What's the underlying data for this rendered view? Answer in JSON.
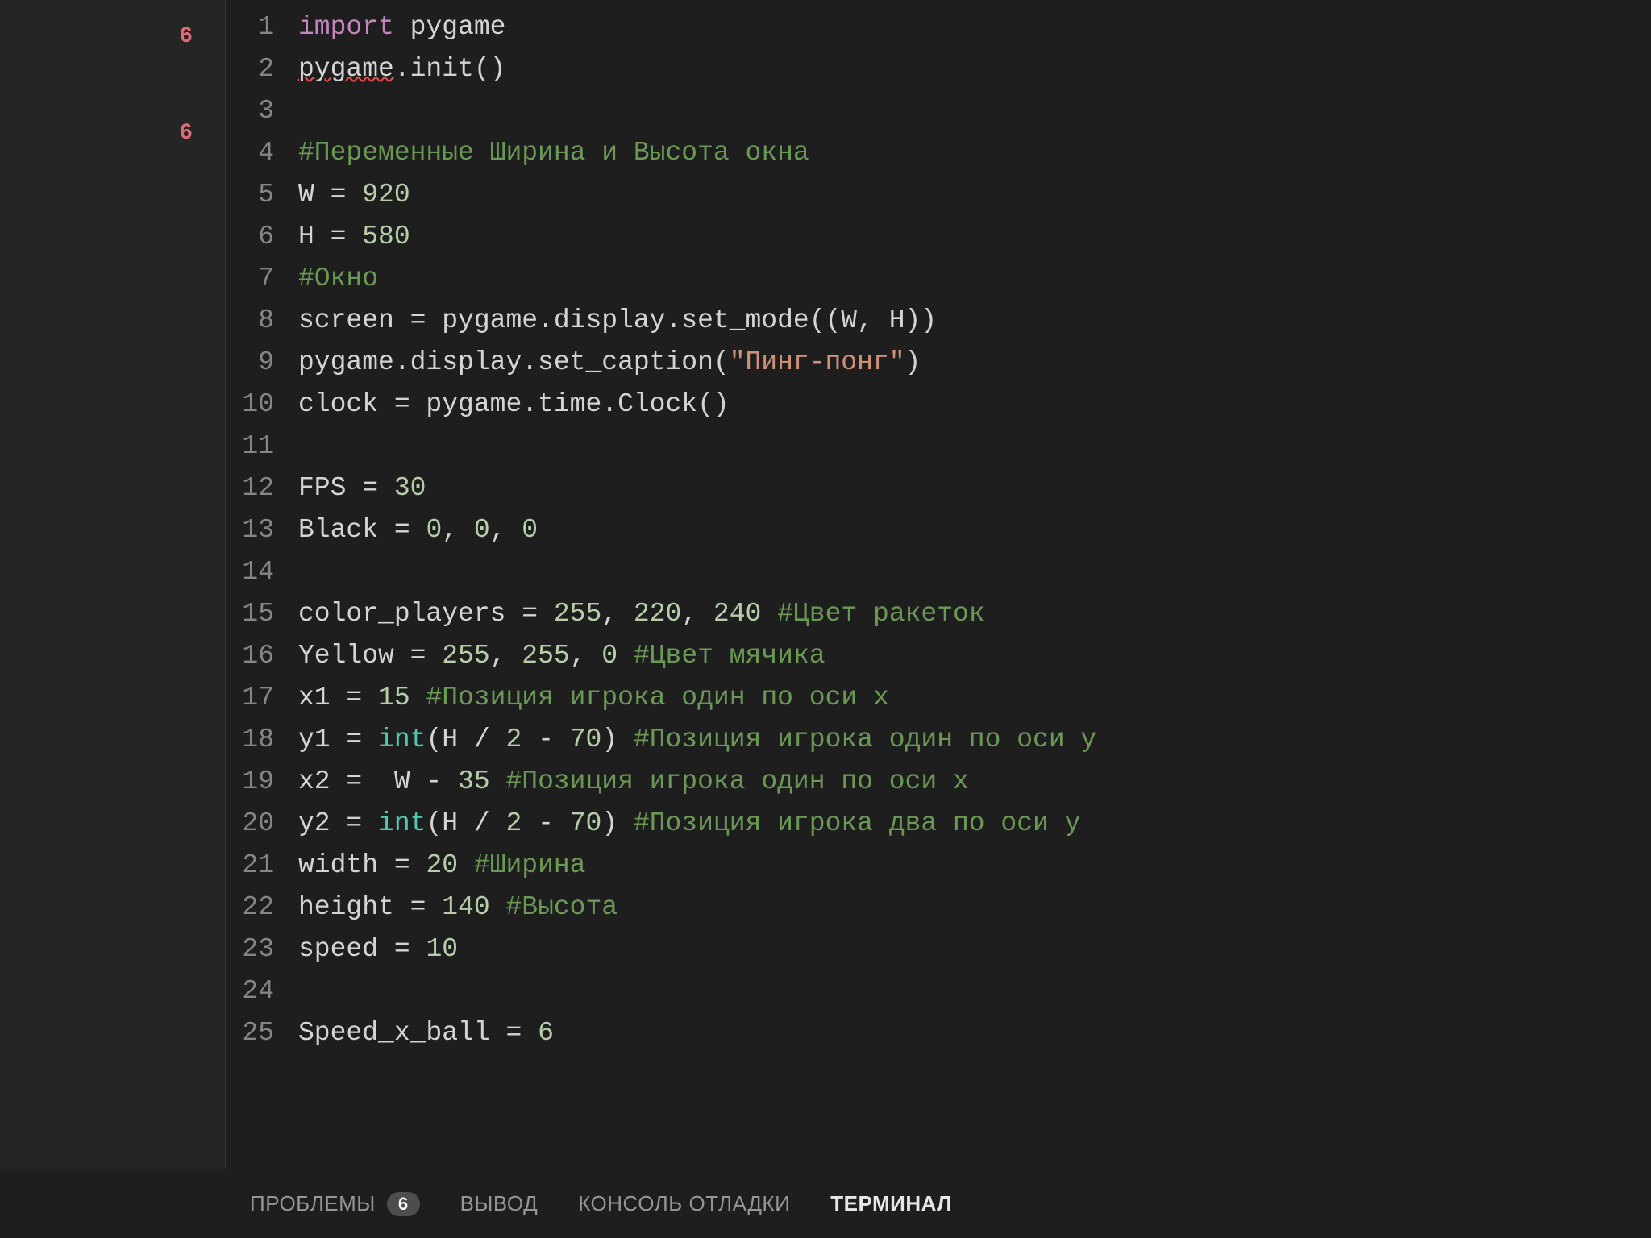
{
  "sidebar": {
    "badge1": "6",
    "badge2": "6"
  },
  "code": {
    "lines": [
      {
        "n": 1,
        "tokens": [
          {
            "c": "kw-import",
            "t": "import"
          },
          {
            "c": "default",
            "t": " "
          },
          {
            "c": "ident",
            "t": "pygame"
          }
        ]
      },
      {
        "n": 2,
        "tokens": [
          {
            "c": "ident squiggle",
            "t": "pygame"
          },
          {
            "c": "default",
            "t": ".init()"
          }
        ]
      },
      {
        "n": 3,
        "tokens": [
          {
            "c": "default",
            "t": ""
          }
        ]
      },
      {
        "n": 4,
        "tokens": [
          {
            "c": "comment",
            "t": "#Переменные Ширина и Высота окна"
          }
        ]
      },
      {
        "n": 5,
        "tokens": [
          {
            "c": "default",
            "t": "W = "
          },
          {
            "c": "number",
            "t": "920"
          }
        ]
      },
      {
        "n": 6,
        "tokens": [
          {
            "c": "default",
            "t": "H = "
          },
          {
            "c": "number",
            "t": "580"
          }
        ]
      },
      {
        "n": 7,
        "tokens": [
          {
            "c": "comment",
            "t": "#Окно"
          }
        ]
      },
      {
        "n": 8,
        "tokens": [
          {
            "c": "default",
            "t": "screen = pygame.display.set_mode((W, H))"
          }
        ]
      },
      {
        "n": 9,
        "tokens": [
          {
            "c": "default",
            "t": "pygame.display.set_caption("
          },
          {
            "c": "string",
            "t": "\"Пинг-понг\""
          },
          {
            "c": "default",
            "t": ")"
          }
        ]
      },
      {
        "n": 10,
        "tokens": [
          {
            "c": "default",
            "t": "clock = pygame.time.Clock()"
          }
        ]
      },
      {
        "n": 11,
        "tokens": [
          {
            "c": "default",
            "t": ""
          }
        ]
      },
      {
        "n": 12,
        "tokens": [
          {
            "c": "default",
            "t": "FPS = "
          },
          {
            "c": "number",
            "t": "30"
          }
        ]
      },
      {
        "n": 13,
        "tokens": [
          {
            "c": "default",
            "t": "Black = "
          },
          {
            "c": "number",
            "t": "0"
          },
          {
            "c": "default",
            "t": ", "
          },
          {
            "c": "number",
            "t": "0"
          },
          {
            "c": "default",
            "t": ", "
          },
          {
            "c": "number",
            "t": "0"
          }
        ]
      },
      {
        "n": 14,
        "tokens": [
          {
            "c": "default",
            "t": ""
          }
        ]
      },
      {
        "n": 15,
        "tokens": [
          {
            "c": "default",
            "t": "color_players = "
          },
          {
            "c": "number",
            "t": "255"
          },
          {
            "c": "default",
            "t": ", "
          },
          {
            "c": "number",
            "t": "220"
          },
          {
            "c": "default",
            "t": ", "
          },
          {
            "c": "number",
            "t": "240"
          },
          {
            "c": "default",
            "t": " "
          },
          {
            "c": "comment",
            "t": "#Цвет ракеток"
          }
        ]
      },
      {
        "n": 16,
        "tokens": [
          {
            "c": "default",
            "t": "Yellow = "
          },
          {
            "c": "number",
            "t": "255"
          },
          {
            "c": "default",
            "t": ", "
          },
          {
            "c": "number",
            "t": "255"
          },
          {
            "c": "default",
            "t": ", "
          },
          {
            "c": "number",
            "t": "0"
          },
          {
            "c": "default",
            "t": " "
          },
          {
            "c": "comment",
            "t": "#Цвет мячика"
          }
        ]
      },
      {
        "n": 17,
        "tokens": [
          {
            "c": "default",
            "t": "x1 = "
          },
          {
            "c": "number",
            "t": "15"
          },
          {
            "c": "default",
            "t": " "
          },
          {
            "c": "comment",
            "t": "#Позиция игрока один по оси х"
          }
        ]
      },
      {
        "n": 18,
        "tokens": [
          {
            "c": "default",
            "t": "y1 = "
          },
          {
            "c": "kw-type",
            "t": "int"
          },
          {
            "c": "default",
            "t": "(H / "
          },
          {
            "c": "number",
            "t": "2"
          },
          {
            "c": "default",
            "t": " - "
          },
          {
            "c": "number",
            "t": "70"
          },
          {
            "c": "default",
            "t": ") "
          },
          {
            "c": "comment",
            "t": "#Позиция игрока один по оси у"
          }
        ]
      },
      {
        "n": 19,
        "tokens": [
          {
            "c": "default",
            "t": "x2 =  W - "
          },
          {
            "c": "number",
            "t": "35"
          },
          {
            "c": "default",
            "t": " "
          },
          {
            "c": "comment",
            "t": "#Позиция игрока один по оси х"
          }
        ]
      },
      {
        "n": 20,
        "tokens": [
          {
            "c": "default",
            "t": "y2 = "
          },
          {
            "c": "kw-type",
            "t": "int"
          },
          {
            "c": "default",
            "t": "(H / "
          },
          {
            "c": "number",
            "t": "2"
          },
          {
            "c": "default",
            "t": " - "
          },
          {
            "c": "number",
            "t": "70"
          },
          {
            "c": "default",
            "t": ") "
          },
          {
            "c": "comment",
            "t": "#Позиция игрока два по оси у"
          }
        ]
      },
      {
        "n": 21,
        "tokens": [
          {
            "c": "default",
            "t": "width = "
          },
          {
            "c": "number",
            "t": "20"
          },
          {
            "c": "default",
            "t": " "
          },
          {
            "c": "comment",
            "t": "#Ширина"
          }
        ]
      },
      {
        "n": 22,
        "tokens": [
          {
            "c": "default",
            "t": "height = "
          },
          {
            "c": "number",
            "t": "140"
          },
          {
            "c": "default",
            "t": " "
          },
          {
            "c": "comment",
            "t": "#Высота"
          }
        ]
      },
      {
        "n": 23,
        "tokens": [
          {
            "c": "default",
            "t": "speed = "
          },
          {
            "c": "number",
            "t": "10"
          }
        ]
      },
      {
        "n": 24,
        "tokens": [
          {
            "c": "default",
            "t": ""
          }
        ]
      },
      {
        "n": 25,
        "tokens": [
          {
            "c": "default",
            "t": "Speed_x_ball = "
          },
          {
            "c": "number",
            "t": "6"
          }
        ]
      }
    ]
  },
  "panel": {
    "tabs": [
      {
        "label": "ПРОБЛЕМЫ",
        "badge": "6",
        "active": false
      },
      {
        "label": "ВЫВОД",
        "active": false
      },
      {
        "label": "КОНСОЛЬ ОТЛАДКИ",
        "active": false
      },
      {
        "label": "ТЕРМИНАЛ",
        "active": true
      }
    ]
  }
}
